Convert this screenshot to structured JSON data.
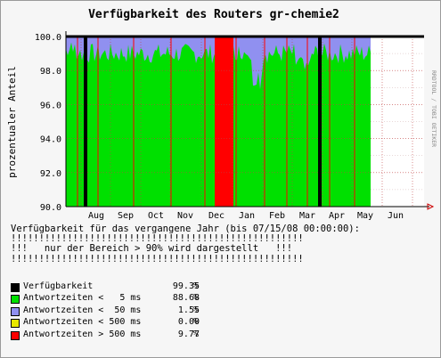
{
  "chart_data": {
    "type": "area",
    "title": "Verfügbarkeit des Routers gr-chemie2",
    "ylabel": "prozentualer Anteil",
    "side_label": "RRDTOOL / TOBI OETIKER",
    "ylim": [
      90.0,
      100.0
    ],
    "yticks": [
      "90.0",
      "92.0",
      "94.0",
      "96.0",
      "98.0",
      "100.0"
    ],
    "x_months": [
      "Aug",
      "Sep",
      "Oct",
      "Nov",
      "Dec",
      "Jan",
      "Feb",
      "Mar",
      "Apr",
      "May",
      "Jun"
    ],
    "grid": true,
    "series": [
      {
        "name": "Verfügbarkeit",
        "color": "#000000"
      },
      {
        "name": "Antwortzeiten <   5 ms",
        "color": "#00e000"
      },
      {
        "name": "Antwortzeiten <  50 ms",
        "color": "#9090f0"
      },
      {
        "name": "Antwortzeiten < 500 ms",
        "color": "#e8e800"
      },
      {
        "name": "Antwortzeiten > 500 ms",
        "color": "#ff0000"
      }
    ]
  },
  "textblock": {
    "line1": "Verfügbarkeit für das vergangene Jahr (bis 07/15/08 00:00:00):",
    "line2": "!!!!!!!!!!!!!!!!!!!!!!!!!!!!!!!!!!!!!!!!!!!!!!!!!!!!",
    "line3": "!!!   nur der Bereich > 90% wird dargestellt   !!!",
    "line4": "!!!!!!!!!!!!!!!!!!!!!!!!!!!!!!!!!!!!!!!!!!!!!!!!!!!!"
  },
  "legend": [
    {
      "label": "Verfügbarkeit",
      "value": "99.35",
      "pct": "%",
      "color": "#000000"
    },
    {
      "label": "Antwortzeiten <   5 ms",
      "value": "88.68",
      "pct": "%",
      "color": "#00e000"
    },
    {
      "label": "Antwortzeiten <  50 ms",
      "value": "1.55",
      "pct": "%",
      "color": "#9090f0"
    },
    {
      "label": "Antwortzeiten < 500 ms",
      "value": "0.00",
      "pct": "%",
      "color": "#e8e800"
    },
    {
      "label": "Antwortzeiten > 500 ms",
      "value": "9.77",
      "pct": "%",
      "color": "#ff0000"
    }
  ]
}
